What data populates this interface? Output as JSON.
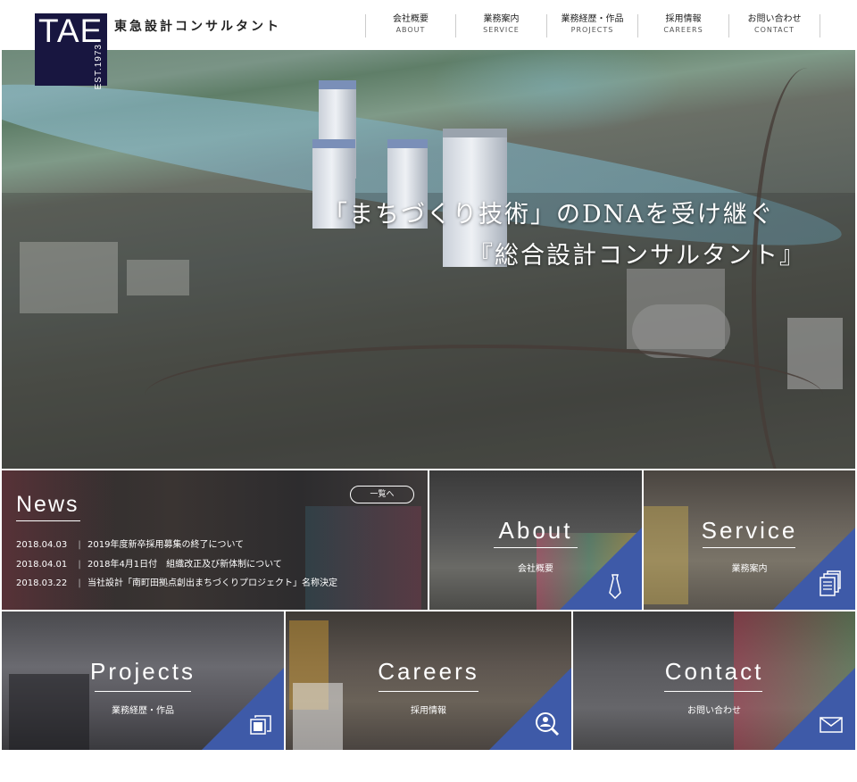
{
  "header": {
    "logo_text": "TAE",
    "logo_est": "EST.1973",
    "company_name": "東急設計コンサルタント",
    "nav": [
      {
        "jp": "会社概要",
        "en": "ABOUT"
      },
      {
        "jp": "業務案内",
        "en": "SERVICE"
      },
      {
        "jp": "業務経歴・作品",
        "en": "PROJECTS"
      },
      {
        "jp": "採用情報",
        "en": "CAREERS"
      },
      {
        "jp": "お問い合わせ",
        "en": "CONTACT"
      }
    ]
  },
  "hero": {
    "line1": "「まちづくり技術」のDNAを受け継ぐ",
    "line2": "『総合設計コンサルタント』"
  },
  "news": {
    "title": "News",
    "more_label": "一覧へ",
    "items": [
      {
        "date": "2018.04.03",
        "text": "2019年度新卒採用募集の終了について"
      },
      {
        "date": "2018.04.01",
        "text": "2018年4月1日付　組織改正及び新体制について"
      },
      {
        "date": "2018.03.22",
        "text": "当社設計「南町田拠点創出まちづくりプロジェクト」名称決定"
      }
    ]
  },
  "tiles": {
    "about": {
      "title": "About",
      "sub": "会社概要"
    },
    "service": {
      "title": "Service",
      "sub": "業務案内"
    },
    "projects": {
      "title": "Projects",
      "sub": "業務経歴・作品"
    },
    "careers": {
      "title": "Careers",
      "sub": "採用情報"
    },
    "contact": {
      "title": "Contact",
      "sub": "お問い合わせ"
    }
  },
  "colors": {
    "accent_blue": "#3e5aa8",
    "logo_navy": "#181640"
  },
  "icons": [
    "tie-icon",
    "documents-icon",
    "photos-icon",
    "search-person-icon",
    "mail-icon"
  ]
}
